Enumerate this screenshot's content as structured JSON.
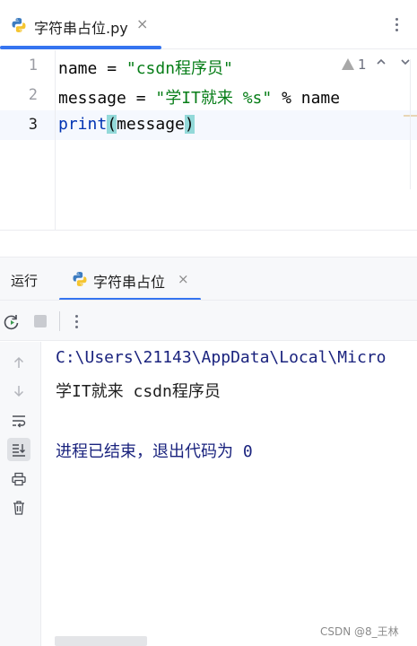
{
  "editor_tab": {
    "label": "字符串占位.py",
    "close": "×"
  },
  "editor": {
    "line_numbers": [
      "1",
      "2",
      "3"
    ],
    "lines": {
      "l1": {
        "ident": "name",
        "op": " = ",
        "str": "\"csdn程序员\""
      },
      "l2": {
        "ident": "message",
        "op": " = ",
        "str": "\"学IT就来 %s\"",
        "rest": " % name"
      },
      "l3": {
        "func": "print",
        "open": "(",
        "arg": "message",
        "close": ")"
      }
    },
    "warnings_count": "1",
    "nav_up": "^",
    "nav_down": "v"
  },
  "run_panel": {
    "title": "运行",
    "tab_label": "字符串占位",
    "tab_close": "×"
  },
  "console": {
    "path_line": "C:\\Users\\21143\\AppData\\Local\\Micro",
    "output_line": "学IT就来 csdn程序员",
    "exit_line": "进程已结束，退出代码为 0"
  },
  "watermark": "CSDN @8_王林",
  "colors": {
    "accent": "#3574f0",
    "string": "#067d17",
    "keyword": "#0033b3",
    "paren_highlight": "#93d9d9"
  }
}
